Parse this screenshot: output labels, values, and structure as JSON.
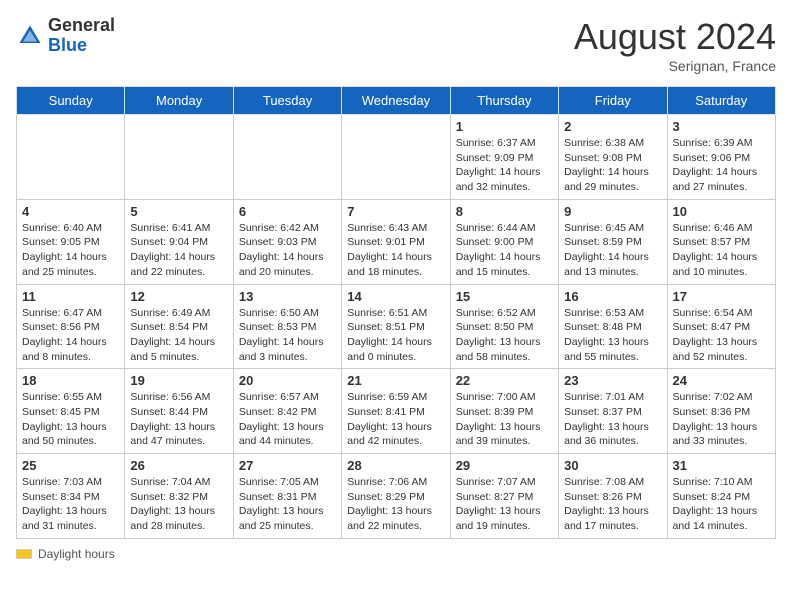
{
  "header": {
    "logo_general": "General",
    "logo_blue": "Blue",
    "month_title": "August 2024",
    "subtitle": "Serignan, France"
  },
  "days_of_week": [
    "Sunday",
    "Monday",
    "Tuesday",
    "Wednesday",
    "Thursday",
    "Friday",
    "Saturday"
  ],
  "weeks": [
    [
      {
        "day": "",
        "sunrise": "",
        "sunset": "",
        "daylight": ""
      },
      {
        "day": "",
        "sunrise": "",
        "sunset": "",
        "daylight": ""
      },
      {
        "day": "",
        "sunrise": "",
        "sunset": "",
        "daylight": ""
      },
      {
        "day": "",
        "sunrise": "",
        "sunset": "",
        "daylight": ""
      },
      {
        "day": "1",
        "sunrise": "Sunrise: 6:37 AM",
        "sunset": "Sunset: 9:09 PM",
        "daylight": "Daylight: 14 hours and 32 minutes."
      },
      {
        "day": "2",
        "sunrise": "Sunrise: 6:38 AM",
        "sunset": "Sunset: 9:08 PM",
        "daylight": "Daylight: 14 hours and 29 minutes."
      },
      {
        "day": "3",
        "sunrise": "Sunrise: 6:39 AM",
        "sunset": "Sunset: 9:06 PM",
        "daylight": "Daylight: 14 hours and 27 minutes."
      }
    ],
    [
      {
        "day": "4",
        "sunrise": "Sunrise: 6:40 AM",
        "sunset": "Sunset: 9:05 PM",
        "daylight": "Daylight: 14 hours and 25 minutes."
      },
      {
        "day": "5",
        "sunrise": "Sunrise: 6:41 AM",
        "sunset": "Sunset: 9:04 PM",
        "daylight": "Daylight: 14 hours and 22 minutes."
      },
      {
        "day": "6",
        "sunrise": "Sunrise: 6:42 AM",
        "sunset": "Sunset: 9:03 PM",
        "daylight": "Daylight: 14 hours and 20 minutes."
      },
      {
        "day": "7",
        "sunrise": "Sunrise: 6:43 AM",
        "sunset": "Sunset: 9:01 PM",
        "daylight": "Daylight: 14 hours and 18 minutes."
      },
      {
        "day": "8",
        "sunrise": "Sunrise: 6:44 AM",
        "sunset": "Sunset: 9:00 PM",
        "daylight": "Daylight: 14 hours and 15 minutes."
      },
      {
        "day": "9",
        "sunrise": "Sunrise: 6:45 AM",
        "sunset": "Sunset: 8:59 PM",
        "daylight": "Daylight: 14 hours and 13 minutes."
      },
      {
        "day": "10",
        "sunrise": "Sunrise: 6:46 AM",
        "sunset": "Sunset: 8:57 PM",
        "daylight": "Daylight: 14 hours and 10 minutes."
      }
    ],
    [
      {
        "day": "11",
        "sunrise": "Sunrise: 6:47 AM",
        "sunset": "Sunset: 8:56 PM",
        "daylight": "Daylight: 14 hours and 8 minutes."
      },
      {
        "day": "12",
        "sunrise": "Sunrise: 6:49 AM",
        "sunset": "Sunset: 8:54 PM",
        "daylight": "Daylight: 14 hours and 5 minutes."
      },
      {
        "day": "13",
        "sunrise": "Sunrise: 6:50 AM",
        "sunset": "Sunset: 8:53 PM",
        "daylight": "Daylight: 14 hours and 3 minutes."
      },
      {
        "day": "14",
        "sunrise": "Sunrise: 6:51 AM",
        "sunset": "Sunset: 8:51 PM",
        "daylight": "Daylight: 14 hours and 0 minutes."
      },
      {
        "day": "15",
        "sunrise": "Sunrise: 6:52 AM",
        "sunset": "Sunset: 8:50 PM",
        "daylight": "Daylight: 13 hours and 58 minutes."
      },
      {
        "day": "16",
        "sunrise": "Sunrise: 6:53 AM",
        "sunset": "Sunset: 8:48 PM",
        "daylight": "Daylight: 13 hours and 55 minutes."
      },
      {
        "day": "17",
        "sunrise": "Sunrise: 6:54 AM",
        "sunset": "Sunset: 8:47 PM",
        "daylight": "Daylight: 13 hours and 52 minutes."
      }
    ],
    [
      {
        "day": "18",
        "sunrise": "Sunrise: 6:55 AM",
        "sunset": "Sunset: 8:45 PM",
        "daylight": "Daylight: 13 hours and 50 minutes."
      },
      {
        "day": "19",
        "sunrise": "Sunrise: 6:56 AM",
        "sunset": "Sunset: 8:44 PM",
        "daylight": "Daylight: 13 hours and 47 minutes."
      },
      {
        "day": "20",
        "sunrise": "Sunrise: 6:57 AM",
        "sunset": "Sunset: 8:42 PM",
        "daylight": "Daylight: 13 hours and 44 minutes."
      },
      {
        "day": "21",
        "sunrise": "Sunrise: 6:59 AM",
        "sunset": "Sunset: 8:41 PM",
        "daylight": "Daylight: 13 hours and 42 minutes."
      },
      {
        "day": "22",
        "sunrise": "Sunrise: 7:00 AM",
        "sunset": "Sunset: 8:39 PM",
        "daylight": "Daylight: 13 hours and 39 minutes."
      },
      {
        "day": "23",
        "sunrise": "Sunrise: 7:01 AM",
        "sunset": "Sunset: 8:37 PM",
        "daylight": "Daylight: 13 hours and 36 minutes."
      },
      {
        "day": "24",
        "sunrise": "Sunrise: 7:02 AM",
        "sunset": "Sunset: 8:36 PM",
        "daylight": "Daylight: 13 hours and 33 minutes."
      }
    ],
    [
      {
        "day": "25",
        "sunrise": "Sunrise: 7:03 AM",
        "sunset": "Sunset: 8:34 PM",
        "daylight": "Daylight: 13 hours and 31 minutes."
      },
      {
        "day": "26",
        "sunrise": "Sunrise: 7:04 AM",
        "sunset": "Sunset: 8:32 PM",
        "daylight": "Daylight: 13 hours and 28 minutes."
      },
      {
        "day": "27",
        "sunrise": "Sunrise: 7:05 AM",
        "sunset": "Sunset: 8:31 PM",
        "daylight": "Daylight: 13 hours and 25 minutes."
      },
      {
        "day": "28",
        "sunrise": "Sunrise: 7:06 AM",
        "sunset": "Sunset: 8:29 PM",
        "daylight": "Daylight: 13 hours and 22 minutes."
      },
      {
        "day": "29",
        "sunrise": "Sunrise: 7:07 AM",
        "sunset": "Sunset: 8:27 PM",
        "daylight": "Daylight: 13 hours and 19 minutes."
      },
      {
        "day": "30",
        "sunrise": "Sunrise: 7:08 AM",
        "sunset": "Sunset: 8:26 PM",
        "daylight": "Daylight: 13 hours and 17 minutes."
      },
      {
        "day": "31",
        "sunrise": "Sunrise: 7:10 AM",
        "sunset": "Sunset: 8:24 PM",
        "daylight": "Daylight: 13 hours and 14 minutes."
      }
    ]
  ],
  "legend": {
    "daylight_hours": "Daylight hours"
  }
}
